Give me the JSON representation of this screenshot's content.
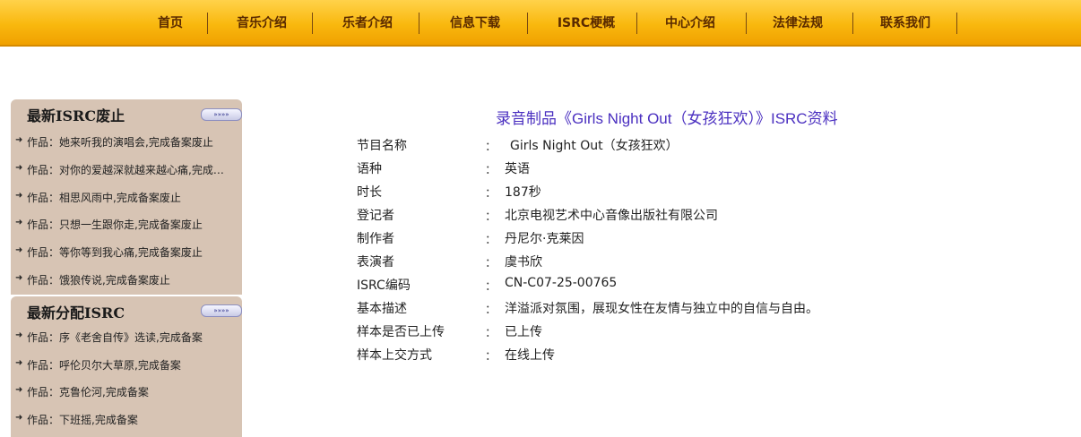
{
  "nav": {
    "items": [
      "首页",
      "音乐介绍",
      "乐者介绍",
      "信息下载",
      "ISRC梗概",
      "中心介绍",
      "法律法规",
      "联系我们"
    ]
  },
  "sidebar": {
    "box1": {
      "title": "最新ISRC废止",
      "more_label": "»»»»",
      "items": [
        "作品：她来听我的演唱会,完成备案废止",
        "作品：对你的爱越深就越来越心痛,完成备案废止",
        "作品：相思风雨中,完成备案废止",
        "作品：只想一生跟你走,完成备案废止",
        "作品：等你等到我心痛,完成备案废止",
        "作品：饿狼传说,完成备案废止"
      ]
    },
    "box2": {
      "title": "最新分配ISRC",
      "more_label": "»»»»",
      "items": [
        "作品：序《老舍自传》选读,完成备案",
        "作品：呼伦贝尔大草原,完成备案",
        "作品：克鲁伦河,完成备案",
        "作品：下班摇,完成备案"
      ]
    }
  },
  "main": {
    "title": "录音制品《Girls Night Out（女孩狂欢）》ISRC资料",
    "rows": [
      {
        "label": "节目名称",
        "value": "Girls Night Out（女孩狂欢）"
      },
      {
        "label": "语种",
        "value": "英语"
      },
      {
        "label": "时长",
        "value": "187秒"
      },
      {
        "label": "登记者",
        "value": "北京电视艺术中心音像出版社有限公司"
      },
      {
        "label": "制作者",
        "value": "丹尼尔·克莱因"
      },
      {
        "label": "表演者",
        "value": "虞书欣"
      },
      {
        "label": "ISRC编码",
        "value": "CN-C07-25-00765"
      },
      {
        "label": "基本描述",
        "value": "洋溢派对氛围，展现女性在友情与独立中的自信与自由。"
      },
      {
        "label": "样本是否已上传",
        "value": "已上传"
      },
      {
        "label": "样本上交方式",
        "value": "在线上传"
      }
    ],
    "colon": "："
  }
}
